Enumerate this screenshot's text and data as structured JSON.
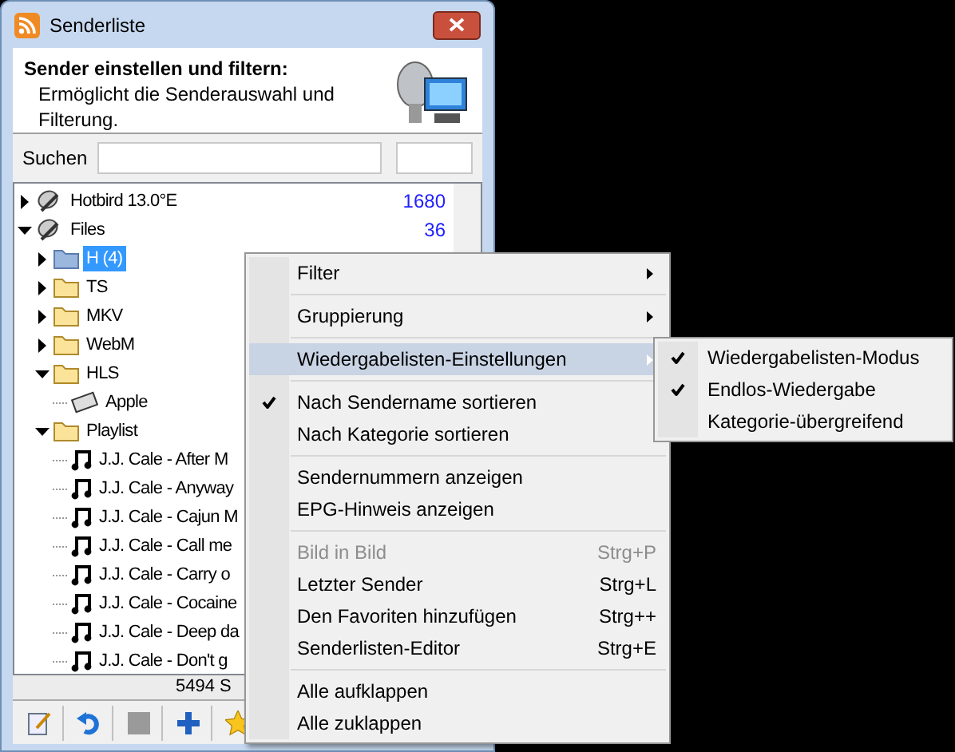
{
  "window": {
    "title": "Senderliste"
  },
  "header": {
    "title": "Sender einstellen und filtern:",
    "description": "Ermöglicht die Senderauswahl und Filterung."
  },
  "search": {
    "label": "Suchen"
  },
  "tree": [
    {
      "label": "Hotbird 13.0°E",
      "count": "1680",
      "kind": "satellite",
      "expanded": false,
      "selected": false
    },
    {
      "label": "Files",
      "count": "36",
      "kind": "satellite",
      "expanded": true,
      "selected": false,
      "children": [
        {
          "label": "H  (4)",
          "kind": "grid-folder",
          "expanded": false,
          "selected": true
        },
        {
          "label": "TS",
          "kind": "folder",
          "expanded": false,
          "selected": false
        },
        {
          "label": "MKV",
          "kind": "folder",
          "expanded": false,
          "selected": false
        },
        {
          "label": "WebM",
          "kind": "folder",
          "expanded": false,
          "selected": false
        },
        {
          "label": "HLS",
          "kind": "folder",
          "expanded": true,
          "selected": false,
          "children": [
            {
              "label": "Apple",
              "kind": "film",
              "selected": false
            }
          ]
        },
        {
          "label": "Playlist",
          "kind": "folder",
          "expanded": true,
          "selected": false,
          "children": [
            {
              "label": "J.J. Cale - After M",
              "kind": "music",
              "selected": false
            },
            {
              "label": "J.J. Cale - Anyway",
              "kind": "music",
              "selected": false
            },
            {
              "label": "J.J. Cale - Cajun M",
              "kind": "music",
              "selected": false
            },
            {
              "label": "J.J. Cale - Call me",
              "kind": "music",
              "selected": false
            },
            {
              "label": "J.J. Cale - Carry o",
              "kind": "music",
              "selected": false
            },
            {
              "label": "J.J. Cale - Cocaine",
              "kind": "music",
              "selected": false
            },
            {
              "label": "J.J. Cale - Deep da",
              "kind": "music",
              "selected": false
            },
            {
              "label": "J.J. Cale - Don't g",
              "kind": "music",
              "selected": false
            }
          ]
        }
      ]
    }
  ],
  "status_bar": {
    "text": "5494 S"
  },
  "toolbar": [
    {
      "kind": "edit"
    },
    {
      "kind": "undo"
    },
    {
      "kind": "stop"
    },
    {
      "kind": "add"
    },
    {
      "kind": "star"
    }
  ],
  "context_menu": [
    {
      "kind": "item",
      "label": "Filter",
      "submenu": true,
      "checked": false,
      "disabled": false,
      "selected": false
    },
    {
      "kind": "separator"
    },
    {
      "kind": "item",
      "label": "Gruppierung",
      "submenu": true,
      "checked": false,
      "disabled": false,
      "selected": false
    },
    {
      "kind": "separator"
    },
    {
      "kind": "item",
      "label": "Wiedergabelisten-Einstellungen",
      "submenu": true,
      "checked": false,
      "disabled": false,
      "selected": true
    },
    {
      "kind": "separator"
    },
    {
      "kind": "item",
      "label": "Nach Sendername sortieren",
      "submenu": false,
      "checked": true,
      "disabled": false,
      "selected": false
    },
    {
      "kind": "item",
      "label": "Nach Kategorie sortieren",
      "submenu": false,
      "checked": false,
      "disabled": false,
      "selected": false
    },
    {
      "kind": "separator"
    },
    {
      "kind": "item",
      "label": "Sendernummern anzeigen",
      "submenu": false,
      "checked": false,
      "disabled": false,
      "selected": false
    },
    {
      "kind": "item",
      "label": "EPG-Hinweis anzeigen",
      "submenu": false,
      "checked": false,
      "disabled": false,
      "selected": false
    },
    {
      "kind": "separator"
    },
    {
      "kind": "item",
      "label": "Bild in Bild",
      "shortcut": "Strg+P",
      "submenu": false,
      "checked": false,
      "disabled": true,
      "selected": false
    },
    {
      "kind": "item",
      "label": "Letzter Sender",
      "shortcut": "Strg+L",
      "submenu": false,
      "checked": false,
      "disabled": false,
      "selected": false
    },
    {
      "kind": "item",
      "label": "Den Favoriten hinzufügen",
      "shortcut": "Strg++",
      "submenu": false,
      "checked": false,
      "disabled": false,
      "selected": false
    },
    {
      "kind": "item",
      "label": "Senderlisten-Editor",
      "shortcut": "Strg+E",
      "submenu": false,
      "checked": false,
      "disabled": false,
      "selected": false
    },
    {
      "kind": "separator"
    },
    {
      "kind": "item",
      "label": "Alle aufklappen",
      "submenu": false,
      "checked": false,
      "disabled": false,
      "selected": false
    },
    {
      "kind": "item",
      "label": "Alle zuklappen",
      "submenu": false,
      "checked": false,
      "disabled": false,
      "selected": false
    }
  ],
  "submenu": [
    {
      "label": "Wiedergabelisten-Modus",
      "checked": true
    },
    {
      "label": "Endlos-Wiedergabe",
      "checked": true
    },
    {
      "label": "Kategorie-übergreifend",
      "checked": false
    }
  ]
}
